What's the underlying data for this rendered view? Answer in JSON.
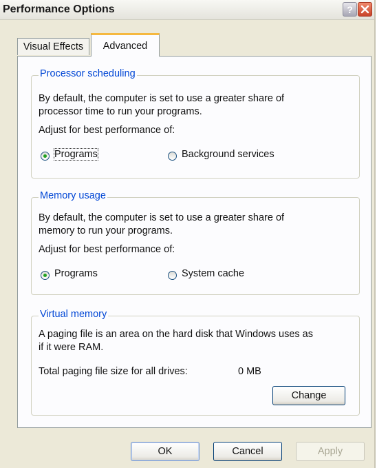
{
  "window": {
    "title": "Performance Options"
  },
  "tabs": [
    {
      "label": "Visual Effects"
    },
    {
      "label": "Advanced",
      "selected": true
    }
  ],
  "processor_scheduling": {
    "legend": "Processor scheduling",
    "description_line1": "By default, the computer is set to use a greater share of",
    "description_line2": "processor time to run your programs.",
    "adjust_label": "Adjust for best performance of:",
    "options": [
      {
        "label": "Programs",
        "selected": true
      },
      {
        "label": "Background services",
        "selected": false
      }
    ]
  },
  "memory_usage": {
    "legend": "Memory usage",
    "description_line1": "By default, the computer is set to use a greater share of",
    "description_line2": "memory to run your programs.",
    "adjust_label": "Adjust for best performance of:",
    "options": [
      {
        "label": "Programs",
        "selected": true
      },
      {
        "label": "System cache",
        "selected": false
      }
    ]
  },
  "virtual_memory": {
    "legend": "Virtual memory",
    "description_line1": "A paging file is an area on the hard disk that Windows uses as",
    "description_line2": "if it were RAM.",
    "total_label": "Total paging file size for all drives:",
    "total_value": "0 MB",
    "change_button": "Change"
  },
  "footer": {
    "ok": "OK",
    "cancel": "Cancel",
    "apply": "Apply"
  },
  "colors": {
    "accent_legend": "#0046d5",
    "radio_checked": "#21a121",
    "tab_highlight": "#f5b83f"
  }
}
